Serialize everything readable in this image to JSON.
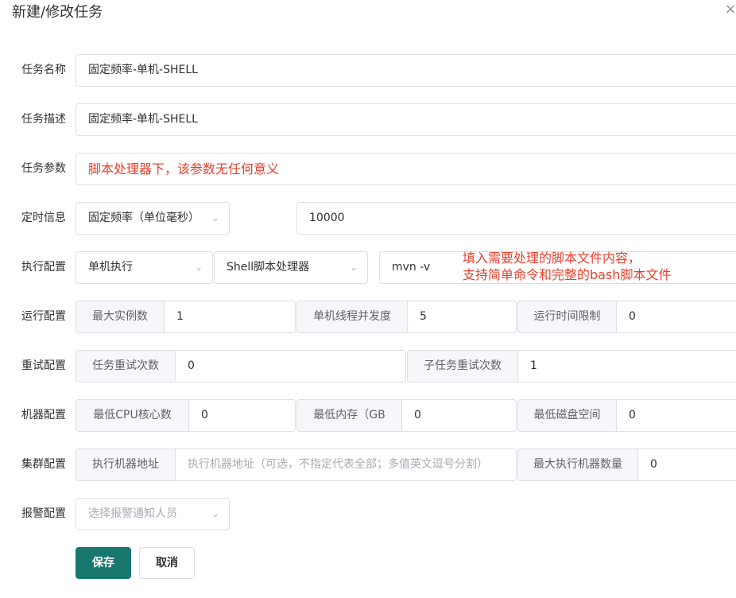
{
  "dialog": {
    "title": "新建/修改任务",
    "close_icon": "close-icon"
  },
  "rows": {
    "name": {
      "label": "任务名称",
      "value": "固定频率-单机-SHELL"
    },
    "desc": {
      "label": "任务描述",
      "value": "固定频率-单机-SHELL"
    },
    "params": {
      "label": "任务参数",
      "value": "脚本处理器下，该参数无任何意义"
    },
    "schedule": {
      "label": "定时信息",
      "type_value": "固定频率（单位毫秒）",
      "interval_value": "10000"
    },
    "execution": {
      "label": "执行配置",
      "mode_value": "单机执行",
      "processor_value": "Shell脚本处理器",
      "script_value": "mvn -v",
      "note_line1": "填入需要处理的脚本文件内容，",
      "note_line2": "支持简单命令和完整的bash脚本文件"
    },
    "runtime": {
      "label": "运行配置",
      "max_instances_label": "最大实例数",
      "max_instances_value": "1",
      "concurrency_label": "单机线程并发度",
      "concurrency_value": "5",
      "time_limit_label": "运行时间限制",
      "time_limit_value": "0"
    },
    "retry": {
      "label": "重试配置",
      "task_retry_label": "任务重试次数",
      "task_retry_value": "0",
      "subtask_retry_label": "子任务重试次数",
      "subtask_retry_value": "1"
    },
    "machine": {
      "label": "机器配置",
      "min_cpu_label": "最低CPU核心数",
      "min_cpu_value": "0",
      "min_mem_label": "最低内存（GB",
      "min_mem_value": "0",
      "min_disk_label": "最低磁盘空间",
      "min_disk_value": "0"
    },
    "cluster": {
      "label": "集群配置",
      "address_label": "执行机器地址",
      "address_placeholder": "执行机器地址（可选，不指定代表全部；多值英文逗号分割）",
      "max_machines_label": "最大执行机器数量",
      "max_machines_value": "0"
    },
    "alarm": {
      "label": "报警配置",
      "placeholder": "选择报警通知人员"
    }
  },
  "buttons": {
    "save": "保存",
    "cancel": "取消"
  },
  "colors": {
    "primary": "#18776f",
    "annotation": "#e8402e"
  }
}
